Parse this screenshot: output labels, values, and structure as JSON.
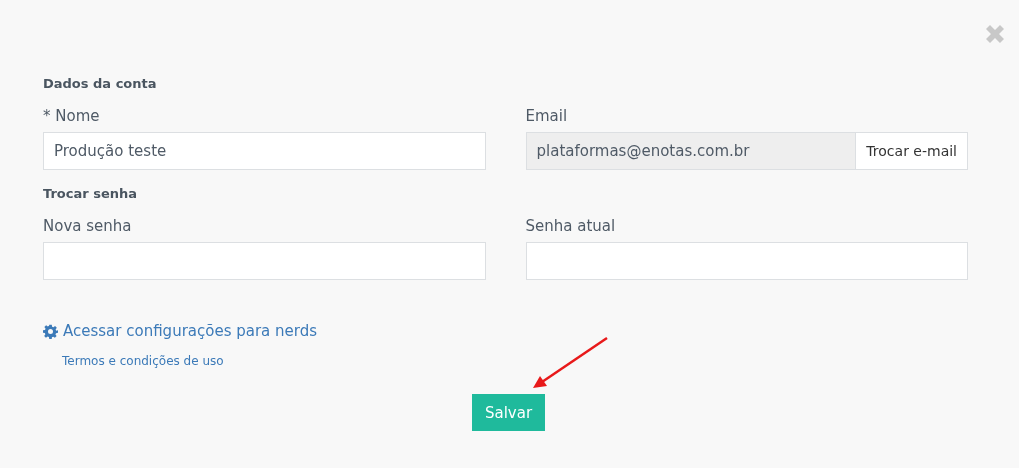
{
  "account": {
    "heading": "Dados da conta",
    "name": {
      "label": "* Nome",
      "value": "Produção teste"
    },
    "email": {
      "label": "Email",
      "value": "plataformas@enotas.com.br",
      "button": "Trocar e-mail"
    }
  },
  "password": {
    "heading": "Trocar senha",
    "new": {
      "label": "Nova senha"
    },
    "current": {
      "label": "Senha atual"
    }
  },
  "links": {
    "nerds": "Acessar configurações para nerds",
    "terms": "Termos e condições de uso"
  },
  "save_button": "Salvar"
}
